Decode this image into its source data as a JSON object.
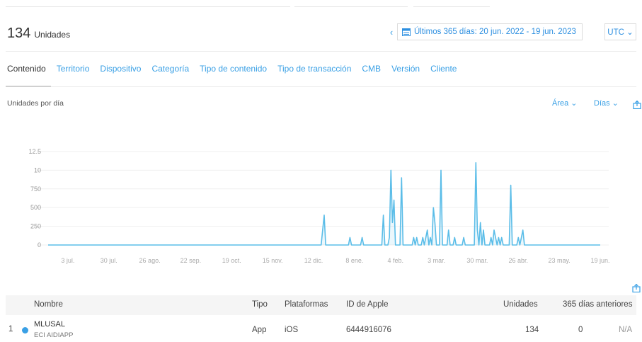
{
  "header": {
    "units_count": "134",
    "units_label": "Unidades"
  },
  "date_nav": {
    "prev": "‹",
    "range": "Últimos 365 días: 20 jun. 2022 - 19 jun. 2023",
    "timezone": "UTC ⌄"
  },
  "tabs": [
    {
      "label": "Contenido",
      "active": true
    },
    {
      "label": "Territorio"
    },
    {
      "label": "Dispositivo"
    },
    {
      "label": "Categoría"
    },
    {
      "label": "Tipo de contenido"
    },
    {
      "label": "Tipo de transacción"
    },
    {
      "label": "CMB"
    },
    {
      "label": "Versión"
    },
    {
      "label": "Cliente"
    }
  ],
  "chart_controls": {
    "title": "Unidades por día",
    "chart_type": "Área ⌄",
    "interval": "Días ⌄"
  },
  "colors": {
    "accent": "#3aa0e5",
    "line": "#5bbde8"
  },
  "chart_data": {
    "type": "area",
    "title": "Unidades por día",
    "y_tick_labels": [
      "12.5",
      "10",
      "750",
      "500",
      "250",
      "0"
    ],
    "y_ticks": [
      12.5,
      10,
      7.5,
      5,
      2.5,
      0
    ],
    "ylim": [
      0,
      12.5
    ],
    "x_tick_labels": [
      "3 jul.",
      "30 jul.",
      "26 ago.",
      "22 sep.",
      "19 oct.",
      "15 nov.",
      "12 dic.",
      "8 ene.",
      "4 feb.",
      "3 mar.",
      "30 mar.",
      "26 abr.",
      "23 may.",
      "19 jun."
    ],
    "x_tick_days": [
      13,
      40,
      67,
      94,
      121,
      148,
      175,
      202,
      229,
      256,
      283,
      310,
      337,
      364
    ],
    "x_range_days": [
      0,
      364
    ],
    "series": [
      {
        "points": [
          [
            0,
            0
          ],
          [
            180,
            0
          ],
          [
            182,
            4
          ],
          [
            183,
            0
          ],
          [
            198,
            0
          ],
          [
            199,
            1
          ],
          [
            200,
            0
          ],
          [
            206,
            0
          ],
          [
            207,
            1
          ],
          [
            208,
            0
          ],
          [
            220,
            0
          ],
          [
            221,
            4
          ],
          [
            222,
            0
          ],
          [
            224,
            0
          ],
          [
            225,
            1
          ],
          [
            226,
            10
          ],
          [
            227,
            3
          ],
          [
            228,
            6
          ],
          [
            229,
            0
          ],
          [
            232,
            0
          ],
          [
            233,
            9
          ],
          [
            234,
            0
          ],
          [
            240,
            0
          ],
          [
            241,
            1
          ],
          [
            242,
            0
          ],
          [
            243,
            1
          ],
          [
            244,
            0
          ],
          [
            246,
            0
          ],
          [
            247,
            1
          ],
          [
            248,
            0
          ],
          [
            249,
            1
          ],
          [
            250,
            2
          ],
          [
            251,
            0
          ],
          [
            252,
            1
          ],
          [
            253,
            0
          ],
          [
            254,
            5
          ],
          [
            255,
            3
          ],
          [
            256,
            0
          ],
          [
            258,
            0
          ],
          [
            259,
            10
          ],
          [
            260,
            0
          ],
          [
            263,
            0
          ],
          [
            264,
            2
          ],
          [
            265,
            0
          ],
          [
            267,
            0
          ],
          [
            268,
            1
          ],
          [
            269,
            0
          ],
          [
            273,
            0
          ],
          [
            274,
            1
          ],
          [
            275,
            0
          ],
          [
            281,
            0
          ],
          [
            282,
            11
          ],
          [
            283,
            2
          ],
          [
            284,
            0
          ],
          [
            285,
            3
          ],
          [
            286,
            0
          ],
          [
            287,
            2
          ],
          [
            288,
            0
          ],
          [
            291,
            0
          ],
          [
            292,
            1
          ],
          [
            293,
            0
          ],
          [
            294,
            2
          ],
          [
            295,
            1
          ],
          [
            296,
            0
          ],
          [
            297,
            1
          ],
          [
            298,
            0
          ],
          [
            299,
            1
          ],
          [
            300,
            0
          ],
          [
            304,
            0
          ],
          [
            305,
            8
          ],
          [
            306,
            0
          ],
          [
            309,
            0
          ],
          [
            310,
            1
          ],
          [
            311,
            0
          ],
          [
            312,
            1
          ],
          [
            313,
            2
          ],
          [
            314,
            0
          ],
          [
            364,
            0
          ]
        ]
      }
    ]
  },
  "table": {
    "headers": [
      "Nombre",
      "Tipo",
      "Plataformas",
      "ID de Apple",
      "Unidades",
      "365 días anteriores"
    ],
    "rows": [
      {
        "num": "1",
        "name": "MLUSAL",
        "subtitle": "ECI AIDIAPP",
        "type": "App",
        "platform": "iOS",
        "apple_id": "6444916076",
        "units": "134",
        "prev": "0",
        "change": "N/A"
      }
    ]
  }
}
